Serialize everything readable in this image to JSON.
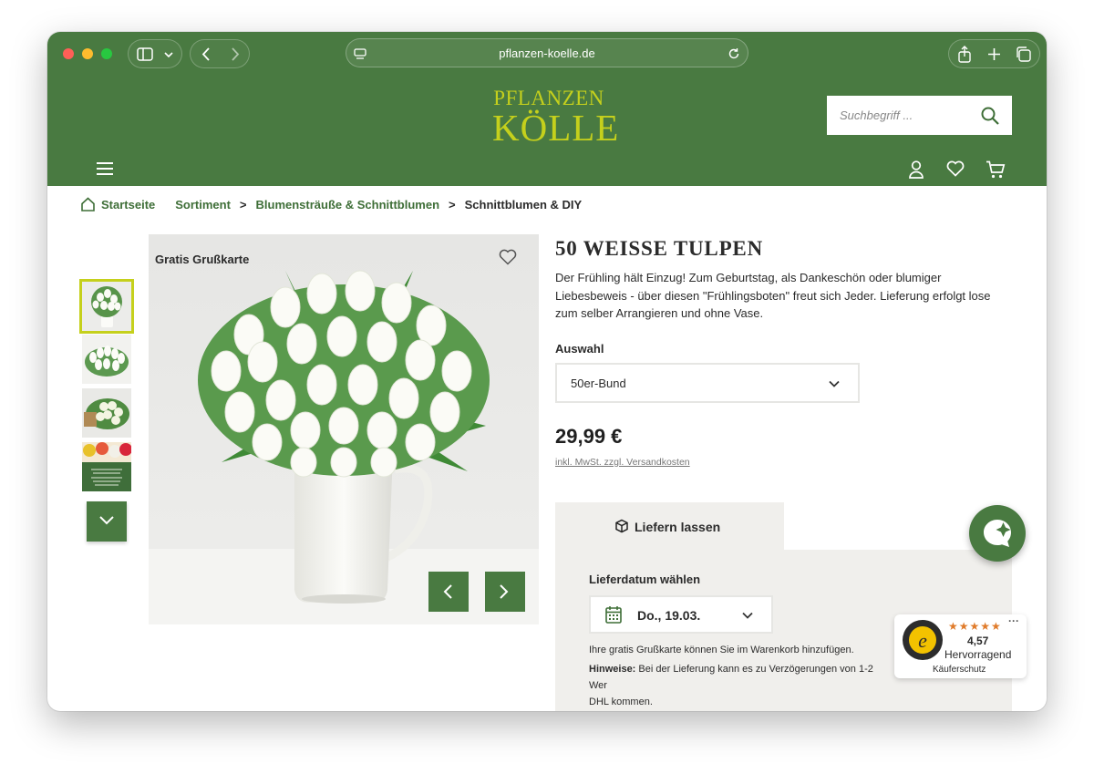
{
  "browser": {
    "url": "pflanzen-koelle.de"
  },
  "header": {
    "logo_line1": "PFLANZEN",
    "logo_line2": "KÖLLE",
    "search_placeholder": "Suchbegriff ..."
  },
  "breadcrumb": {
    "items": [
      {
        "label": "Startseite"
      },
      {
        "label": "Sortiment"
      },
      {
        "label": "Blumensträuße & Schnittblumen"
      },
      {
        "label": "Schnittblumen & DIY"
      }
    ]
  },
  "gallery": {
    "badge": "Gratis Grußkarte",
    "card_thumb_text": "Gratis Grußkarte zum Wunschtermin"
  },
  "product": {
    "title": "50 WEISSE TULPEN",
    "description": "Der Frühling hält Einzug! Zum Geburtstag, als Dankeschön oder blumiger Liebesbeweis - über diesen \"Frühlingsboten\" freut sich Jeder. Lieferung erfolgt lose zum selber Arrangieren und ohne Vase.",
    "option_label": "Auswahl",
    "option_value": "50er-Bund",
    "price": "29,99 €",
    "vat_note": "inkl. MwSt. zzgl. Versandkosten"
  },
  "delivery": {
    "tab_label": "Liefern lassen",
    "date_label": "Lieferdatum wählen",
    "date_value": "Do., 19.03.",
    "note1": "Ihre gratis Grußkarte können Sie im Warenkorb hinzufügen.",
    "note2_bold": "Hinweise:",
    "note2_text": " Bei der Lieferung kann es zu Verzögerungen von 1-2 Wer",
    "note2_line2": "DHL kommen."
  },
  "trusted_shops": {
    "stars": "★★★★★",
    "score": "4,57",
    "rating_word": "Hervorragend",
    "label": "Käuferschutz",
    "more": "···"
  },
  "colors": {
    "brand_green": "#497a41",
    "logo_yellow": "#c5d01c",
    "panel_bg": "#f0efec"
  }
}
